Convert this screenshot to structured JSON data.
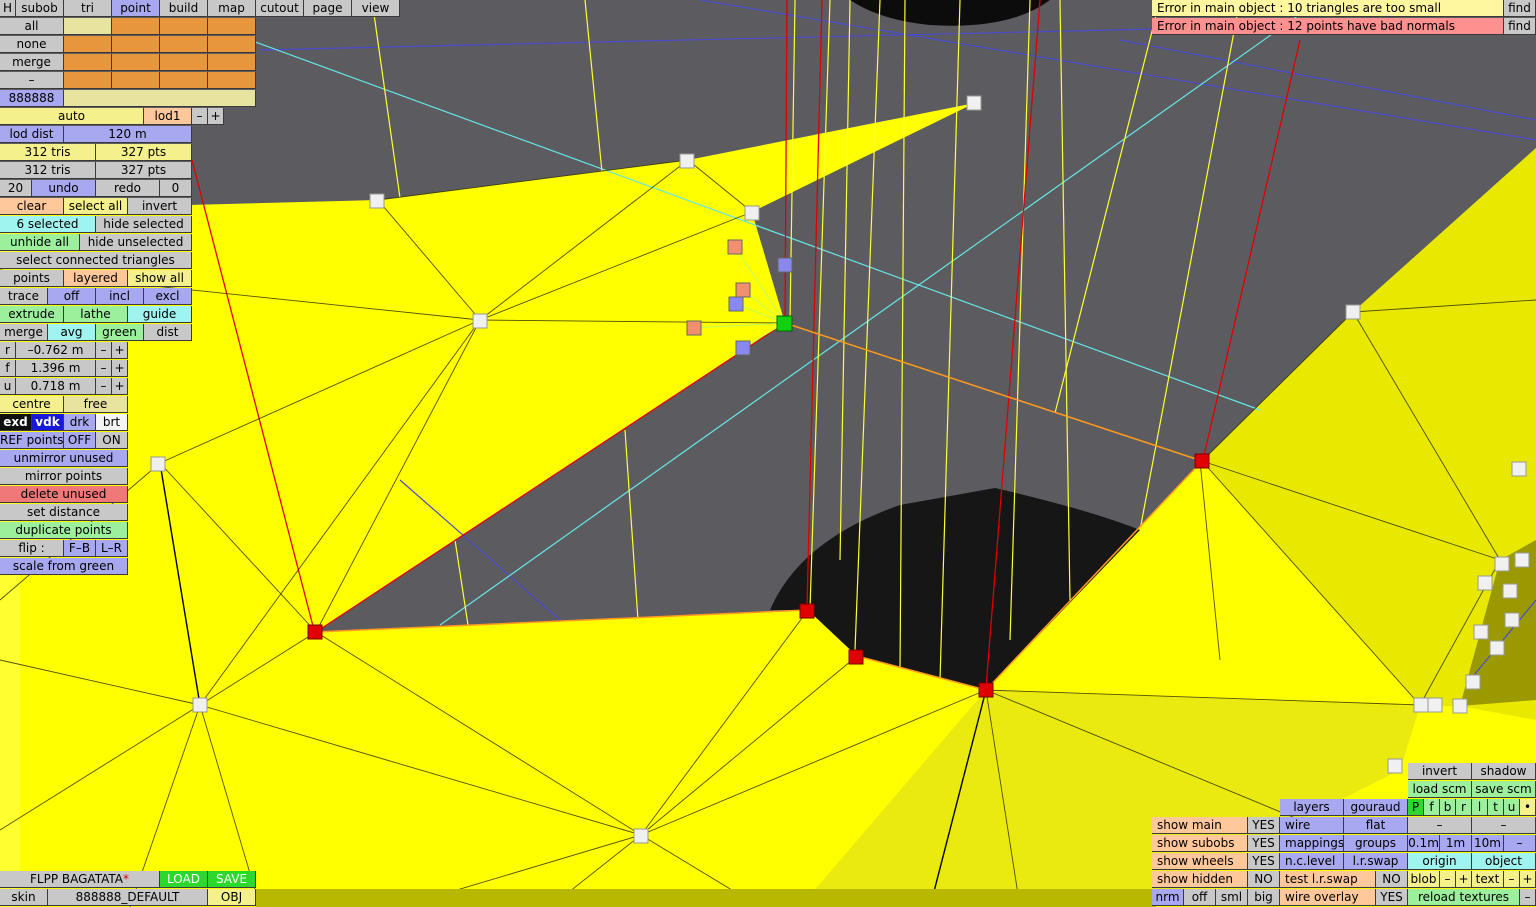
{
  "colors": {
    "viewport_bg": "#5c5c60",
    "mesh_yellow": "#ffff00",
    "selected_point": "#e00000",
    "green_point": "#10d010"
  },
  "top_tabs": [
    "H",
    "subob",
    "tri",
    "point",
    "build",
    "map",
    "cutout",
    "page",
    "view"
  ],
  "active_tab": "point",
  "left_rows": {
    "all": "all",
    "none": "none",
    "merge": "merge",
    "dash": "–",
    "code": "888888",
    "auto": "auto",
    "lod1": "lod1",
    "minus": "–",
    "plus": "+",
    "lod_dist": "lod dist",
    "lod_dist_val": "120 m",
    "tris1": "312 tris",
    "pts1": "327 pts",
    "tris2": "312 tris",
    "pts2": "327 pts",
    "undo_count": "20",
    "undo": "undo",
    "redo": "redo",
    "redo_count": "0",
    "clear": "clear",
    "select_all": "select all",
    "invert": "invert",
    "selected": "6 selected",
    "hide_selected": "hide selected",
    "unhide_all": "unhide all",
    "hide_unselected": "hide unselected",
    "select_connected": "select connected triangles",
    "points": "points",
    "layered": "layered",
    "show_all": "show all",
    "trace": "trace",
    "off": "off",
    "incl": "incl",
    "excl": "excl",
    "extrude": "extrude",
    "lathe": "lathe",
    "guide": "guide",
    "merge2": "merge",
    "avg": "avg",
    "green": "green",
    "dist": "dist",
    "r_label": "r",
    "r_val": "–0.762 m",
    "f_label": "f",
    "f_val": "1.396 m",
    "u_label": "u",
    "u_val": "0.718 m",
    "centre": "centre",
    "free": "free",
    "exd": "exd",
    "vdk": "vdk",
    "drk": "drk",
    "brt": "brt",
    "ref_points": "REF points",
    "ref_off": "OFF",
    "ref_on": "ON",
    "unmirror": "unmirror unused",
    "mirror": "mirror points",
    "delete_unused": "delete unused",
    "set_distance": "set distance",
    "duplicate": "duplicate points",
    "flip": "flip :",
    "fb": "F–B",
    "lr": "L–R",
    "scale_green": "scale from green"
  },
  "errors": [
    {
      "text": "Error in main object : 10 triangles are too small",
      "find": "find"
    },
    {
      "text": "Error in main object : 12 points have bad normals",
      "find": "find"
    }
  ],
  "bottom_left": {
    "car": "FLPP BAGATATA",
    "star": "*",
    "load": "LOAD",
    "save": "SAVE",
    "skin": "skin",
    "skin_name": "888888_DEFAULT",
    "obj": "OBJ"
  },
  "bottom_right": {
    "invert": "invert",
    "shadow": "shadow",
    "load_scm": "load scm",
    "save_scm": "save scm",
    "layers": "layers",
    "gouraud": "gouraud",
    "letters": [
      "P",
      "f",
      "b",
      "r",
      "l",
      "t",
      "u",
      "•"
    ],
    "show_main": "show main",
    "show_main_v": "YES",
    "wire": "wire",
    "flat": "flat",
    "dash1": "–",
    "dash2": "–",
    "show_subobs": "show subobs",
    "show_subobs_v": "YES",
    "mappings": "mappings",
    "groups": "groups",
    "m01": "0.1m",
    "m1": "1m",
    "m10": "10m",
    "dash3": "–",
    "show_wheels": "show wheels",
    "show_wheels_v": "YES",
    "nclevel": "n.c.level",
    "lrswap": "l.r.swap",
    "origin": "origin",
    "object": "object",
    "show_hidden": "show hidden",
    "show_hidden_v": "NO",
    "test_lr": "test l.r.swap",
    "test_lr_v": "NO",
    "blob": "blob",
    "bm": "–",
    "bp": "+",
    "text": "text",
    "tm": "–",
    "tp": "+",
    "nrm": "nrm",
    "off": "off",
    "sml": "sml",
    "big": "big",
    "wire_overlay": "wire overlay",
    "wire_overlay_v": "YES",
    "reload": "reload textures",
    "rm": "–"
  }
}
